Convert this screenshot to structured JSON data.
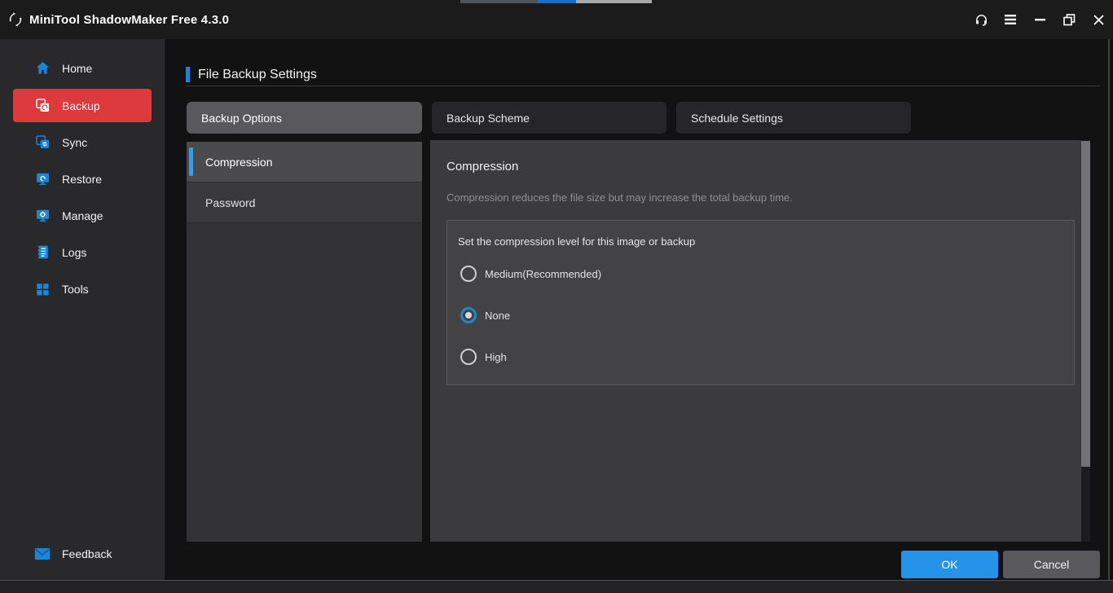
{
  "titlebar": {
    "title": "MiniTool ShadowMaker Free 4.3.0",
    "icons": [
      "support-headset",
      "menu",
      "minimize",
      "restore",
      "close"
    ],
    "top_strips": {
      "left_color": "#50555b",
      "middle_color": "#1a6fc4",
      "right_color": "#a8a8a8"
    }
  },
  "sidebar": {
    "items": [
      {
        "label": "Home",
        "icon": "home-icon",
        "selected": false
      },
      {
        "label": "Backup",
        "icon": "backup-icon",
        "selected": true
      },
      {
        "label": "Sync",
        "icon": "sync-icon",
        "selected": false
      },
      {
        "label": "Restore",
        "icon": "restore-icon",
        "selected": false
      },
      {
        "label": "Manage",
        "icon": "manage-icon",
        "selected": false
      },
      {
        "label": "Logs",
        "icon": "logs-icon",
        "selected": false
      },
      {
        "label": "Tools",
        "icon": "tools-icon",
        "selected": false
      }
    ],
    "feedback_label": "Feedback"
  },
  "main": {
    "page_title": "File Backup Settings",
    "tabs": [
      {
        "label": "Backup Options",
        "selected": true
      },
      {
        "label": "Backup Scheme",
        "selected": false
      },
      {
        "label": "Schedule Settings",
        "selected": false
      }
    ],
    "option_nav": [
      {
        "label": "Compression",
        "selected": true
      },
      {
        "label": "Password",
        "selected": false
      }
    ],
    "content": {
      "heading": "Compression",
      "description": "Compression reduces the file size but may increase the total backup time.",
      "group_label": "Set the compression level for this image or backup",
      "radio_options": [
        {
          "label": "Medium(Recommended)",
          "selected": false
        },
        {
          "label": "None",
          "selected": true
        },
        {
          "label": "High",
          "selected": false
        }
      ]
    },
    "buttons": {
      "ok": "OK",
      "cancel": "Cancel"
    }
  },
  "colors": {
    "brand_red": "#dc3a3c",
    "accent_blue": "#1a86d9",
    "ok_button_blue": "#2493e8",
    "radio_selected_blue": "#1f86c9",
    "titlebar_bg": "#1b1b1c",
    "sidebar_bg": "#29292b",
    "panel_bg": "#3b3b3d"
  }
}
